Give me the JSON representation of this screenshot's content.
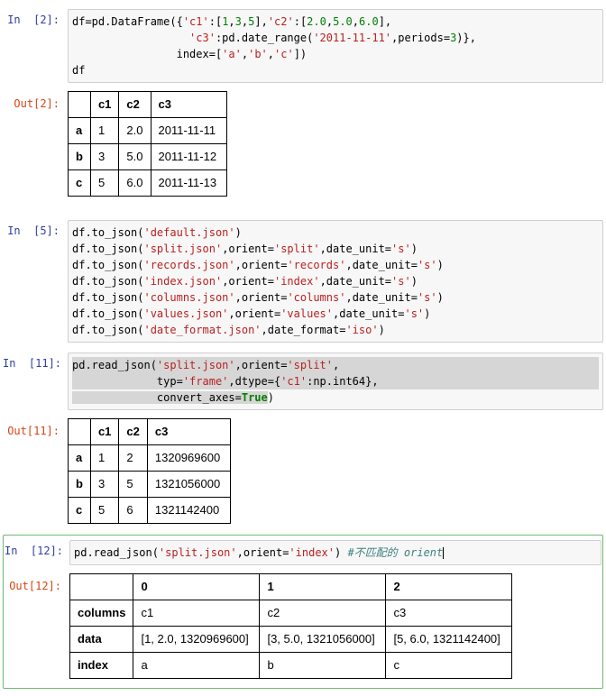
{
  "colors": {
    "in_prompt": "#303F9F",
    "out_prompt": "#D84315",
    "string_token": "#BA2121",
    "number_token": "#008000",
    "keyword_token": "#008000",
    "comment_token": "#408080",
    "selection_highlight": "#d6d6d6",
    "active_cell_border": "#6fba72",
    "code_background": "#f7f7f7",
    "code_border": "#cfcfcf",
    "table_border": "#000000"
  },
  "cells": [
    {
      "in_prompt": "In  [2]:",
      "code": [
        {
          "sel": "none",
          "tokens": [
            {
              "t": "p",
              "x": "df=pd.DataFrame({"
            },
            {
              "t": "s",
              "x": "'c1'"
            },
            {
              "t": "p",
              "x": ":["
            },
            {
              "t": "n",
              "x": "1"
            },
            {
              "t": "p",
              "x": ","
            },
            {
              "t": "n",
              "x": "3"
            },
            {
              "t": "p",
              "x": ","
            },
            {
              "t": "n",
              "x": "5"
            },
            {
              "t": "p",
              "x": "],"
            },
            {
              "t": "s",
              "x": "'c2'"
            },
            {
              "t": "p",
              "x": ":["
            },
            {
              "t": "n",
              "x": "2.0"
            },
            {
              "t": "p",
              "x": ","
            },
            {
              "t": "n",
              "x": "5.0"
            },
            {
              "t": "p",
              "x": ","
            },
            {
              "t": "n",
              "x": "6.0"
            },
            {
              "t": "p",
              "x": "],"
            }
          ]
        },
        {
          "sel": "none",
          "tokens": [
            {
              "t": "p",
              "x": "                  "
            },
            {
              "t": "s",
              "x": "'c3'"
            },
            {
              "t": "p",
              "x": ":pd.date_range("
            },
            {
              "t": "s",
              "x": "'2011-11-11'"
            },
            {
              "t": "p",
              "x": ",periods="
            },
            {
              "t": "n",
              "x": "3"
            },
            {
              "t": "p",
              "x": ")},"
            }
          ]
        },
        {
          "sel": "none",
          "tokens": [
            {
              "t": "p",
              "x": "                index=["
            },
            {
              "t": "s",
              "x": "'a'"
            },
            {
              "t": "p",
              "x": ","
            },
            {
              "t": "s",
              "x": "'b'"
            },
            {
              "t": "p",
              "x": ","
            },
            {
              "t": "s",
              "x": "'c'"
            },
            {
              "t": "p",
              "x": "])"
            }
          ]
        },
        {
          "sel": "none",
          "tokens": [
            {
              "t": "p",
              "x": "df"
            }
          ]
        }
      ],
      "out_prompt": "Out[2]:",
      "out_table": {
        "headers": [
          "",
          "c1",
          "c2",
          "c3"
        ],
        "rows": [
          [
            "a",
            "1",
            "2.0",
            "2011-11-11"
          ],
          [
            "b",
            "3",
            "5.0",
            "2011-11-12"
          ],
          [
            "c",
            "5",
            "6.0",
            "2011-11-13"
          ]
        ]
      }
    },
    {
      "in_prompt": "In  [5]:",
      "code": [
        {
          "sel": "none",
          "tokens": [
            {
              "t": "p",
              "x": "df.to_json("
            },
            {
              "t": "s",
              "x": "'default.json'"
            },
            {
              "t": "p",
              "x": ")"
            }
          ]
        },
        {
          "sel": "none",
          "tokens": [
            {
              "t": "p",
              "x": "df.to_json("
            },
            {
              "t": "s",
              "x": "'split.json'"
            },
            {
              "t": "p",
              "x": ",orient="
            },
            {
              "t": "s",
              "x": "'split'"
            },
            {
              "t": "p",
              "x": ",date_unit="
            },
            {
              "t": "s",
              "x": "'s'"
            },
            {
              "t": "p",
              "x": ")"
            }
          ]
        },
        {
          "sel": "none",
          "tokens": [
            {
              "t": "p",
              "x": "df.to_json("
            },
            {
              "t": "s",
              "x": "'records.json'"
            },
            {
              "t": "p",
              "x": ",orient="
            },
            {
              "t": "s",
              "x": "'records'"
            },
            {
              "t": "p",
              "x": ",date_unit="
            },
            {
              "t": "s",
              "x": "'s'"
            },
            {
              "t": "p",
              "x": ")"
            }
          ]
        },
        {
          "sel": "none",
          "tokens": [
            {
              "t": "p",
              "x": "df.to_json("
            },
            {
              "t": "s",
              "x": "'index.json'"
            },
            {
              "t": "p",
              "x": ",orient="
            },
            {
              "t": "s",
              "x": "'index'"
            },
            {
              "t": "p",
              "x": ",date_unit="
            },
            {
              "t": "s",
              "x": "'s'"
            },
            {
              "t": "p",
              "x": ")"
            }
          ]
        },
        {
          "sel": "none",
          "tokens": [
            {
              "t": "p",
              "x": "df.to_json("
            },
            {
              "t": "s",
              "x": "'columns.json'"
            },
            {
              "t": "p",
              "x": ",orient="
            },
            {
              "t": "s",
              "x": "'columns'"
            },
            {
              "t": "p",
              "x": ",date_unit="
            },
            {
              "t": "s",
              "x": "'s'"
            },
            {
              "t": "p",
              "x": ")"
            }
          ]
        },
        {
          "sel": "none",
          "tokens": [
            {
              "t": "p",
              "x": "df.to_json("
            },
            {
              "t": "s",
              "x": "'values.json'"
            },
            {
              "t": "p",
              "x": ",orient="
            },
            {
              "t": "s",
              "x": "'values'"
            },
            {
              "t": "p",
              "x": ",date_unit="
            },
            {
              "t": "s",
              "x": "'s'"
            },
            {
              "t": "p",
              "x": ")"
            }
          ]
        },
        {
          "sel": "none",
          "tokens": [
            {
              "t": "p",
              "x": "df.to_json("
            },
            {
              "t": "s",
              "x": "'date_format.json'"
            },
            {
              "t": "p",
              "x": ",date_format="
            },
            {
              "t": "s",
              "x": "'iso'"
            },
            {
              "t": "p",
              "x": ")"
            }
          ]
        }
      ],
      "out_prompt": null,
      "out_table": null
    },
    {
      "in_prompt": "In  [11]:",
      "code": [
        {
          "sel": "full",
          "tokens": [
            {
              "t": "p",
              "x": "pd.read_json("
            },
            {
              "t": "s",
              "x": "'split.json'"
            },
            {
              "t": "p",
              "x": ",orient="
            },
            {
              "t": "s",
              "x": "'split'"
            },
            {
              "t": "p",
              "x": ","
            }
          ]
        },
        {
          "sel": "full",
          "tokens": [
            {
              "t": "p",
              "x": "             typ="
            },
            {
              "t": "s",
              "x": "'frame'"
            },
            {
              "t": "p",
              "x": ",dtype={"
            },
            {
              "t": "s",
              "x": "'c1'"
            },
            {
              "t": "p",
              "x": ":np.int64},"
            }
          ]
        },
        {
          "sel": "none",
          "tokens": [
            {
              "t": "p",
              "x": "             convert_axes=",
              "sel": true
            },
            {
              "t": "k",
              "x": "True",
              "sel": true
            },
            {
              "t": "p",
              "x": ")"
            }
          ]
        }
      ],
      "out_prompt": "Out[11]:",
      "out_table": {
        "headers": [
          "",
          "c1",
          "c2",
          "c3"
        ],
        "rows": [
          [
            "a",
            "1",
            "2",
            "1320969600"
          ],
          [
            "b",
            "3",
            "5",
            "1321056000"
          ],
          [
            "c",
            "5",
            "6",
            "1321142400"
          ]
        ]
      }
    },
    {
      "in_prompt": "In  [12]:",
      "active": true,
      "code": [
        {
          "sel": "none",
          "tokens": [
            {
              "t": "p",
              "x": "pd.read_json("
            },
            {
              "t": "s",
              "x": "'split.json'"
            },
            {
              "t": "p",
              "x": ",orient="
            },
            {
              "t": "s",
              "x": "'index'"
            },
            {
              "t": "p",
              "x": ") "
            },
            {
              "t": "c",
              "x": "#不匹配的 orient"
            },
            {
              "t": "caret",
              "x": ""
            }
          ]
        }
      ],
      "out_prompt": "Out[12]:",
      "out_table": {
        "headers": [
          "",
          "0",
          "1",
          "2"
        ],
        "rows": [
          [
            "columns",
            "c1",
            "c2",
            "c3"
          ],
          [
            "data",
            "[1, 2.0, 1320969600]",
            "[3, 5.0, 1321056000]",
            "[5, 6.0, 1321142400]"
          ],
          [
            "index",
            "a",
            "b",
            "c"
          ]
        ]
      }
    }
  ]
}
